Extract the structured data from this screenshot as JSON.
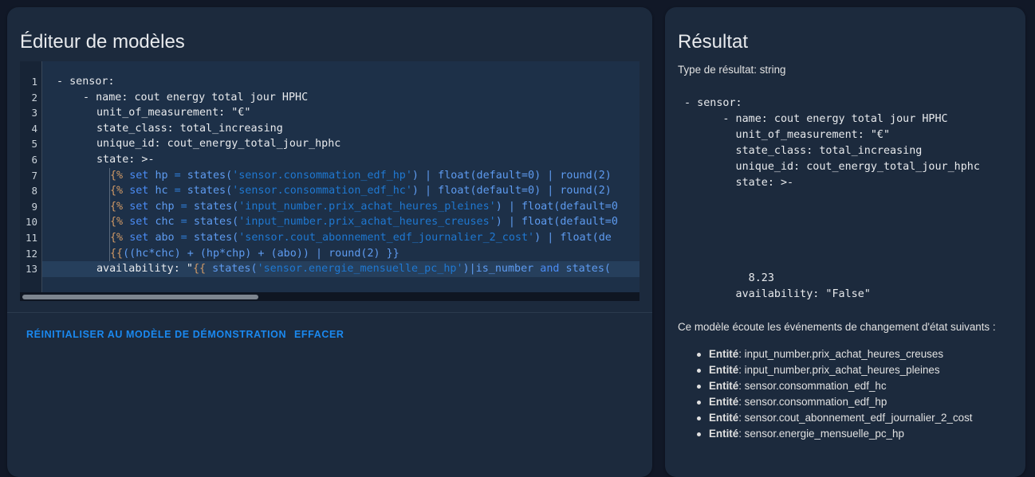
{
  "editor": {
    "title": "Éditeur de modèles",
    "line_numbers": [
      "1",
      "2",
      "3",
      "4",
      "5",
      "6",
      "7",
      "8",
      "9",
      "10",
      "11",
      "12",
      "13"
    ],
    "buttons": {
      "reset": "RÉINITIALISER AU MODÈLE DE DÉMONSTRATION",
      "clear": "EFFACER"
    }
  },
  "code": {
    "l1": "- sensor:",
    "l2": "- name: cout energy total jour HPHC",
    "l3": "unit_of_measurement: \"€\"",
    "l4": "state_class: total_increasing",
    "l5": "unique_id: cout_energy_total_jour_hphc",
    "l6": "state: >-",
    "l7": {
      "open": "{%",
      "set": "set",
      "var": "hp",
      "eq": " = ",
      "fn": "states(",
      "str": "'sensor.consommation_edf_hp'",
      "rest": ") | float(default=0) | round(2)"
    },
    "l8": {
      "open": "{%",
      "set": "set",
      "var": "hc",
      "eq": " = ",
      "fn": "states(",
      "str": "'sensor.consommation_edf_hc'",
      "rest": ") | float(default=0) | round(2)"
    },
    "l9": {
      "open": "{%",
      "set": "set",
      "var": "chp",
      "eq": " = ",
      "fn": "states(",
      "str": "'input_number.prix_achat_heures_pleines'",
      "rest": ") | float(default=0"
    },
    "l10": {
      "open": "{%",
      "set": "set",
      "var": "chc",
      "eq": " = ",
      "fn": "states(",
      "str": "'input_number.prix_achat_heures_creuses'",
      "rest": ") | float(default=0"
    },
    "l11": {
      "open": "{%",
      "set": "set",
      "var": "abo",
      "eq": " = ",
      "fn": "states(",
      "str": "'sensor.cout_abonnement_edf_journalier_2_cost'",
      "rest": ") | float(de"
    },
    "l12": {
      "open": "{{",
      "expr": "((hc*chc) + (hp*chp) + (abo)) | round(2) }}"
    },
    "l13": {
      "key": "availability: \"",
      "open": "{{",
      "fn": " states(",
      "str": "'sensor.energie_mensuelle_pc_hp'",
      "rest": ")|is_number ",
      "and": "and",
      "tail": " states("
    }
  },
  "result": {
    "title": "Résultat",
    "type_label": "Type de résultat: string",
    "output": " - sensor:\n       - name: cout energy total jour HPHC\n         unit_of_measurement: \"€\"\n         state_class: total_increasing\n         unique_id: cout_energy_total_jour_hphc\n         state: >-\n\n\n\n\n\n           8.23\n         availability: \"False\"",
    "listen_text": "Ce modèle écoute les événements de changement d'état suivants :",
    "entity_label": "Entité",
    "entities": [
      ": input_number.prix_achat_heures_creuses",
      ": input_number.prix_achat_heures_pleines",
      ": sensor.consommation_edf_hc",
      ": sensor.consommation_edf_hp",
      ": sensor.cout_abonnement_edf_journalier_2_cost",
      ": sensor.energie_mensuelle_pc_hp"
    ]
  }
}
